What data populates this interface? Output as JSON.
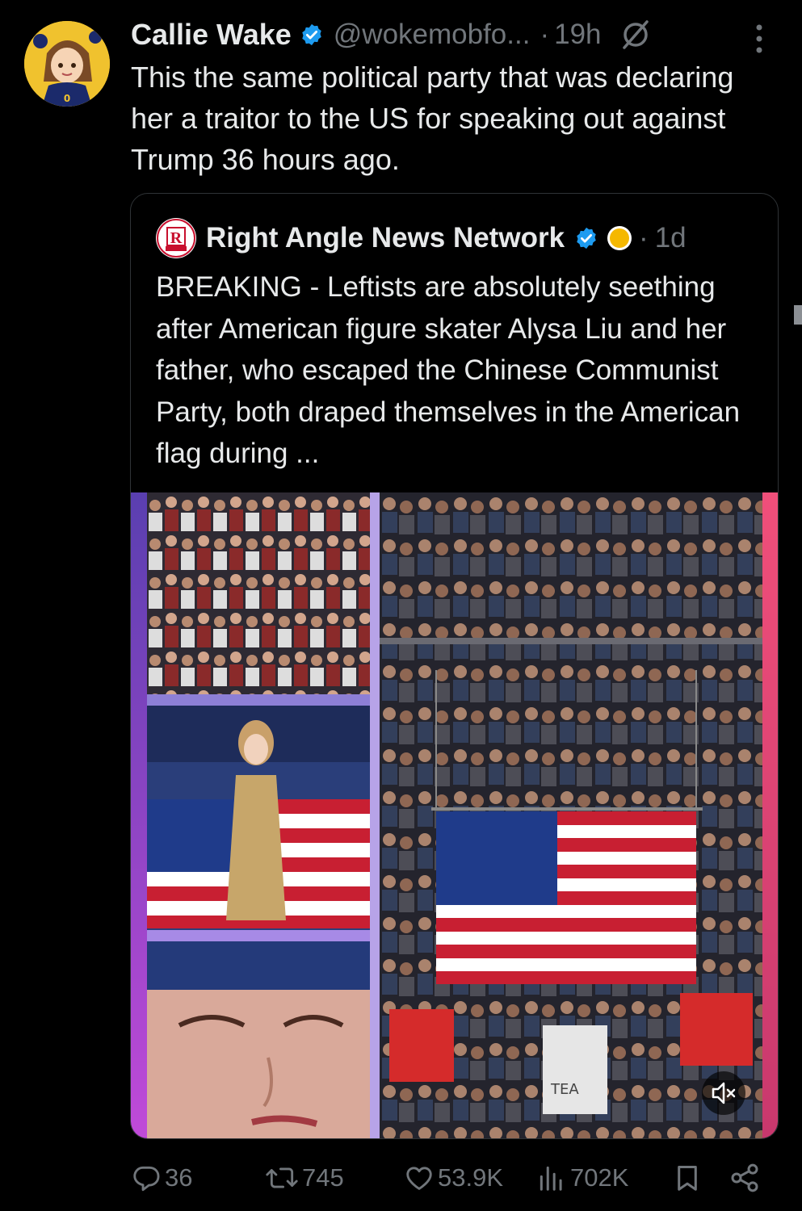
{
  "tweet": {
    "author_name": "Callie Wake",
    "handle": "@wokemobfo...",
    "time_separator": "·",
    "time": "19h",
    "text": "This the same political party that was declaring her a traitor to the US for speaking out against Trump 36 hours ago.",
    "avatar_icon": "cartoon-avatar",
    "verified_color": "#1d9bf0"
  },
  "quoted": {
    "logo_text": "R",
    "author_name": "Right Angle News Network",
    "time": "1d",
    "time_separator": "·",
    "text": "BREAKING - Leftists are absolutely seething after American figure skater Alysa Liu and her father, who escaped the Chinese Communist Party, both draped themselves in the American flag during ...",
    "media_caption_text": "TEA"
  },
  "actions": {
    "replies": "36",
    "reposts": "745",
    "likes": "53.9K",
    "views": "702K"
  },
  "colors": {
    "background": "#000000",
    "text": "#e7e9ea",
    "muted": "#71767b",
    "verified": "#1d9bf0",
    "border": "#2f3336"
  }
}
